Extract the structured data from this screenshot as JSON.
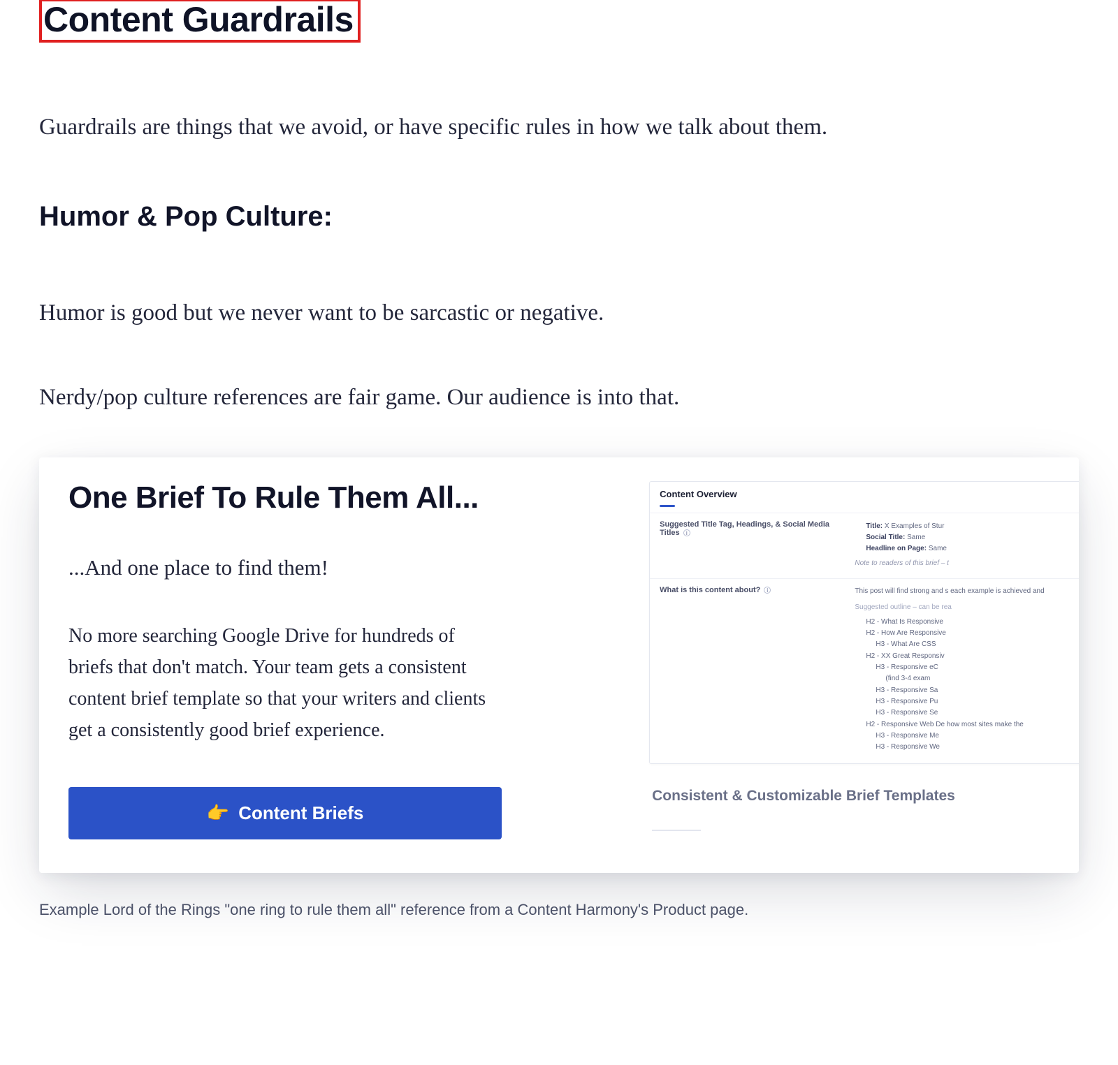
{
  "heading": "Content Guardrails",
  "intro": "Guardrails are things that we avoid, or have specific rules in how we talk about them.",
  "subheading": "Humor & Pop Culture:",
  "para1": "Humor is good but we never want to be sarcastic or negative.",
  "para2": "Nerdy/pop culture references are fair game. Our audience is into that.",
  "card": {
    "title": "One Brief To Rule Them All...",
    "subtitle": "...And one place to find them!",
    "body": "No more searching Google Drive for hundreds of briefs that don't match. Your team gets a consistent content brief template so that your writers and clients get a consistently good brief experience.",
    "cta_emoji": "👉",
    "cta_label": "Content Briefs"
  },
  "panel": {
    "header": "Content Overview",
    "section1": {
      "label": "Suggested Title Tag, Headings, & Social Media Titles",
      "bullets": {
        "b1_label": "Title:",
        "b1_val": "X Examples of Stur",
        "b2_label": "Social Title:",
        "b2_val": "Same",
        "b3_label": "Headline on Page:",
        "b3_val": "Same"
      },
      "note": "Note to readers of this brief – t"
    },
    "section2": {
      "label": "What is this content about?",
      "lead": "This post will find strong and s each example is achieved and",
      "suggest": "Suggested outline – can be rea",
      "outline": {
        "i1": "H2 - What Is Responsive",
        "i2": "H2 - How Are Responsive",
        "i2a": "H3 - What Are CSS",
        "i3": "H2 - XX Great Responsiv",
        "i3a": "H3 - Responsive eC",
        "i3a1": "(find 3-4 exam",
        "i3b": "H3 - Responsive Sa",
        "i3c": "H3 - Responsive Pu",
        "i3d": "H3 - Responsive Se",
        "i4": "H2 - Responsive Web De how most sites make the",
        "i4a": "H3 - Responsive Me",
        "i4b": "H3 - Responsive We"
      }
    },
    "right_caption": "Consistent & Customizable Brief Templates"
  },
  "figure_caption": "Example Lord of the Rings \"one ring to rule them all\" reference from a Content Harmony's Product page."
}
